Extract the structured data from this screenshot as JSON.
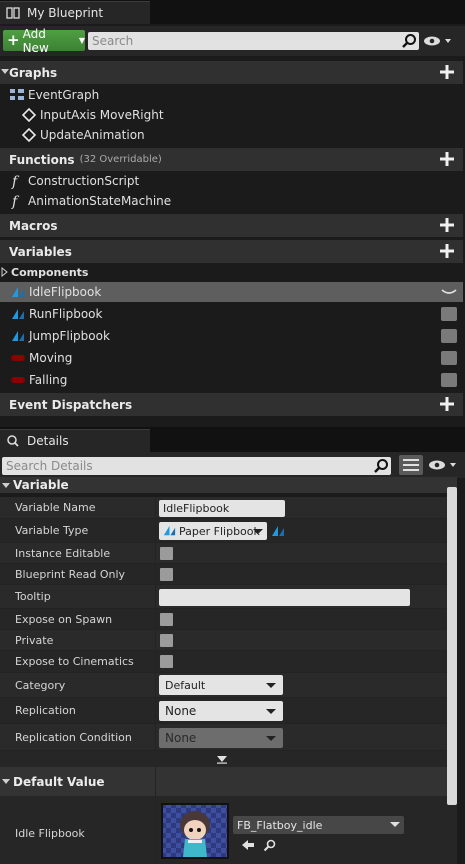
{
  "blueprint_tab": {
    "title": "My Blueprint"
  },
  "toolbar": {
    "add_new_label": "Add New",
    "search_placeholder": "Search"
  },
  "sections": {
    "graphs": "Graphs",
    "functions": "Functions",
    "functions_sub": "(32 Overridable)",
    "macros": "Macros",
    "variables": "Variables",
    "event_dispatchers": "Event Dispatchers"
  },
  "graphs": [
    "EventGraph",
    "InputAxis MoveRight",
    "UpdateAnimation"
  ],
  "functions": [
    "ConstructionScript",
    "AnimationStateMachine"
  ],
  "components_header": "Components",
  "variables": [
    {
      "name": "IdleFlipbook",
      "kind": "flipbook"
    },
    {
      "name": "RunFlipbook",
      "kind": "flipbook"
    },
    {
      "name": "JumpFlipbook",
      "kind": "flipbook"
    },
    {
      "name": "Moving",
      "kind": "bool"
    },
    {
      "name": "Falling",
      "kind": "bool"
    }
  ],
  "details_tab": {
    "title": "Details",
    "search_placeholder": "Search Details"
  },
  "details": {
    "variable_header": "Variable",
    "rows": {
      "variable_name_label": "Variable Name",
      "variable_name_value": "IdleFlipbook",
      "variable_type_label": "Variable Type",
      "variable_type_value": "Paper Flipbook",
      "instance_editable_label": "Instance Editable",
      "read_only_label": "Blueprint Read Only",
      "tooltip_label": "Tooltip",
      "tooltip_value": "",
      "expose_spawn_label": "Expose on Spawn",
      "private_label": "Private",
      "expose_cine_label": "Expose to Cinematics",
      "category_label": "Category",
      "category_value": "Default",
      "replication_label": "Replication",
      "replication_value": "None",
      "replication_cond_label": "Replication Condition",
      "replication_cond_value": "None"
    },
    "default_header": "Default Value",
    "idle_flipbook_label": "Idle Flipbook",
    "asset_name": "FB_Flatboy_idle"
  },
  "colors": {
    "green_button": "#4a9a3f",
    "bool_pin": "#8c0000",
    "object_pin": "#1f9ae0",
    "selected_row": "#5e5e5e"
  }
}
